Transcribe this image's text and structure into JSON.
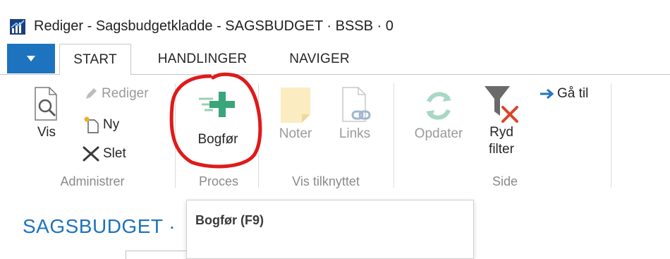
{
  "window": {
    "title": "Rediger - Sagsbudgetkladde - SAGSBUDGET · BSSB · 0",
    "icon": "dynamics-nav-icon"
  },
  "ribbon": {
    "tabs": [
      {
        "label": "START",
        "active": true
      },
      {
        "label": "HANDLINGER",
        "active": false
      },
      {
        "label": "NAVIGER",
        "active": false
      }
    ],
    "groups": {
      "administrer": {
        "label": "Administrer",
        "vis": "Vis",
        "rediger": "Rediger",
        "ny": "Ny",
        "slet": "Slet"
      },
      "proces": {
        "label": "Proces",
        "bogfor": "Bogfør"
      },
      "vis_tilknyttet": {
        "label": "Vis tilknyttet",
        "noter": "Noter",
        "links": "Links"
      },
      "side": {
        "label": "Side",
        "opdater": "Opdater",
        "ryd_filter_line1": "Ryd",
        "ryd_filter_line2": "filter",
        "ga_til": "Gå til"
      }
    }
  },
  "page": {
    "title": "SAGSBUDGET ·"
  },
  "tooltip": {
    "text": "Bogfør (F9)"
  },
  "colors": {
    "accent": "#1e73be",
    "highlight": "#dcecfb",
    "annotation": "#e01a1a",
    "post_green": "#3aa57a"
  }
}
